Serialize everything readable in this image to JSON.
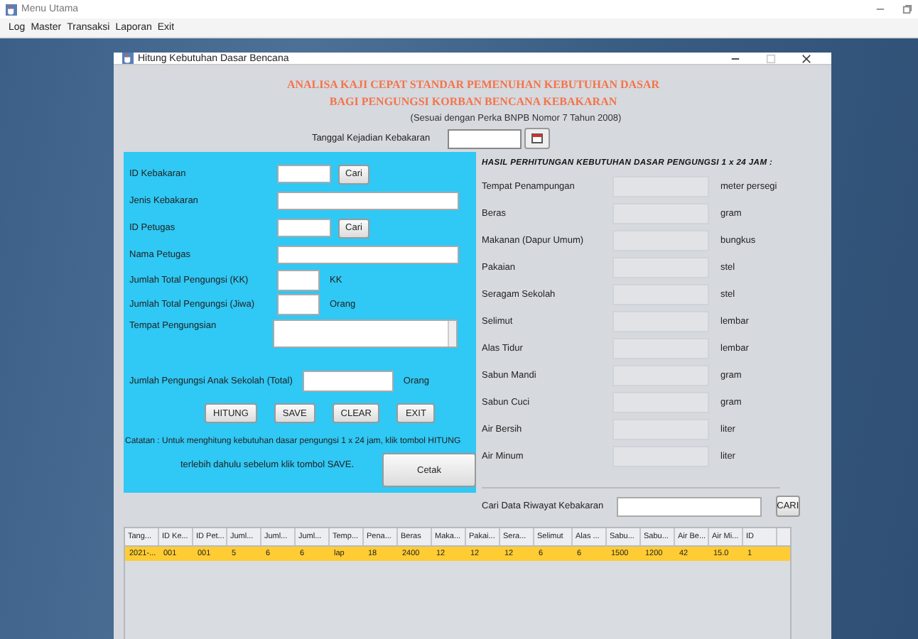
{
  "app": {
    "title": "Menu Utama",
    "menu": [
      "Log",
      "Master",
      "Transaksi",
      "Laporan",
      "Exit"
    ]
  },
  "dialog": {
    "title": "Hitung Kebutuhan Dasar Bencana",
    "heading": [
      "ANALISA KAJI CEPAT STANDAR PEMENUHAN KEBUTUHAN DASAR",
      "BAGI PENGUNGSI KORBAN BENCANA KEBAKARAN"
    ],
    "subheading": "(Sesuai dengan Perka BNPB Nomor 7 Tahun 2008)",
    "date_label": "Tanggal Kejadian Kebakaran",
    "form": [
      {
        "kind": "search",
        "label": "ID Kebakaran",
        "button": "Cari"
      },
      {
        "kind": "wide",
        "label": "Jenis Kebakaran"
      },
      {
        "kind": "search",
        "label": "ID Petugas",
        "button": "Cari"
      },
      {
        "kind": "wide",
        "label": "Nama Petugas"
      },
      {
        "kind": "unit",
        "label": "Jumlah Total Pengungsi (KK)",
        "unit": "KK"
      },
      {
        "kind": "unit",
        "label": "Jumlah Total Pengungsi (Jiwa)",
        "unit": "Orang"
      },
      {
        "kind": "area",
        "label": "Tempat Pengungsian"
      },
      {
        "kind": "school",
        "label": "Jumlah Pengungsi Anak Sekolah (Total)",
        "unit": "Orang"
      }
    ],
    "buttons": [
      "HITUNG",
      "SAVE",
      "CLEAR",
      "EXIT"
    ],
    "note": [
      "Catatan : Untuk menghitung kebutuhan dasar pengungsi 1 x 24 jam, klik tombol HITUNG",
      "terlebih dahulu sebelum klik tombol SAVE."
    ],
    "print_button": "Cetak",
    "results_heading": "HASIL PERHITUNGAN KEBUTUHAN DASAR PENGUNGSI 1 x 24 JAM :",
    "results": [
      {
        "label": "Tempat Penampungan",
        "unit": "meter persegi"
      },
      {
        "label": "Beras",
        "unit": "gram"
      },
      {
        "label": "Makanan (Dapur Umum)",
        "unit": "bungkus"
      },
      {
        "label": "Pakaian",
        "unit": "stel"
      },
      {
        "label": "Seragam Sekolah",
        "unit": "stel"
      },
      {
        "label": "Selimut",
        "unit": "lembar"
      },
      {
        "label": "Alas Tidur",
        "unit": "lembar"
      },
      {
        "label": "Sabun Mandi",
        "unit": "gram"
      },
      {
        "label": "Sabun Cuci",
        "unit": "gram"
      },
      {
        "label": "Air Bersih",
        "unit": "liter"
      },
      {
        "label": "Air Minum",
        "unit": "liter"
      }
    ],
    "history_label": "Cari Data Riwayat Kebakaran",
    "history_button": "CARI",
    "table": {
      "columns": [
        "Tang...",
        "ID Ke...",
        "ID Pet...",
        "Juml...",
        "Juml...",
        "Juml...",
        "Temp...",
        "Pena...",
        "Beras",
        "Maka...",
        "Pakai...",
        "Sera...",
        "Selimut",
        "Alas ...",
        "Sabu...",
        "Sabu...",
        "Air Be...",
        "Air Mi...",
        "ID"
      ],
      "rows": [
        {
          "selected": true,
          "cells": [
            "2021-...",
            "001",
            "001",
            "5",
            "6",
            "6",
            "lap",
            "18",
            "2400",
            "12",
            "12",
            "12",
            "6",
            "6",
            "1500",
            "1200",
            "42",
            "15.0",
            "1"
          ]
        }
      ]
    }
  }
}
